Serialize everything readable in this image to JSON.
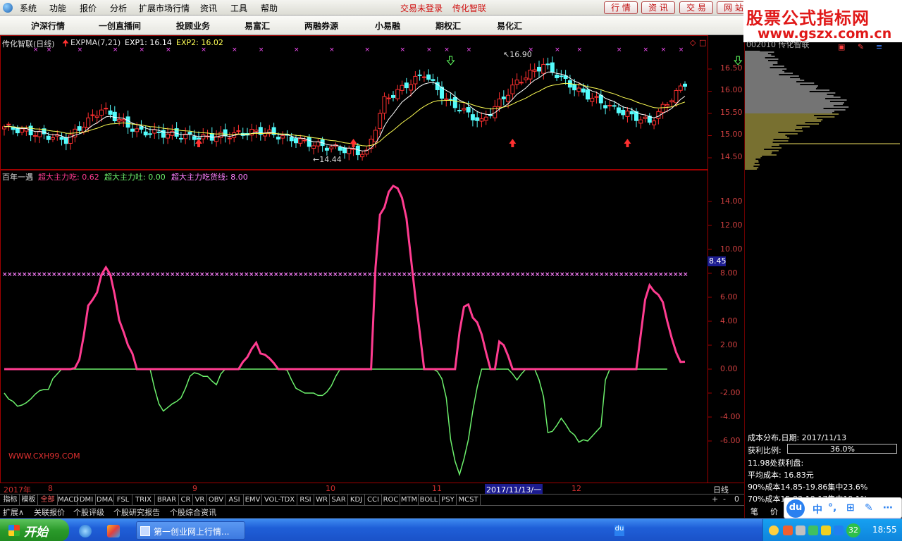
{
  "menubar": {
    "items": [
      "系统",
      "功能",
      "报价",
      "分析",
      "扩展市场行情",
      "资讯",
      "工具",
      "帮助"
    ],
    "status_login": "交易未登录",
    "status_brand": "传化智联",
    "buttons": [
      "行 情",
      "资 讯",
      "交 易",
      "网 站"
    ]
  },
  "toolbar2": {
    "items": [
      "沪深行情",
      "一创直播间",
      "投顾业务",
      "易富汇",
      "两融券源",
      "小易融",
      "期权汇",
      "易化汇"
    ]
  },
  "logo": {
    "line1": "股票公式指标网",
    "line2": "www.gszx.com.cn"
  },
  "main_chart": {
    "title": "传化智联(日线)",
    "indicator": "EXPMA(7,21)",
    "exp1": "EXP1: 16.14",
    "exp2": "EXP2: 16.02",
    "price_ticks": [
      "16.50",
      "16.00",
      "15.50",
      "15.00",
      "14.50"
    ],
    "high_label": "16.90",
    "low_label": "14.44",
    "colors": {
      "up": "#ff3030",
      "down": "#54fcfc",
      "exp1": "#ffffff",
      "exp2": "#ffff54",
      "mark": "#ff50ff"
    }
  },
  "sub_chart": {
    "title": "百年一遇",
    "l1": "超大主力吃: 0.62",
    "l2": "超大主力吐: 0.00",
    "l3": "超大主力吃货线: 8.00",
    "y_ticks": [
      "14.00",
      "12.00",
      "10.00",
      "8.00",
      "6.00",
      "4.00",
      "2.00",
      "0.00",
      "-2.00",
      "-4.00",
      "-6.00"
    ],
    "current_value": "8.45",
    "watermark": "WWW.CXH99.COM",
    "colors": {
      "eat": "#ff3c90",
      "spit": "#6cf06c",
      "threshold": "#ff80ff"
    }
  },
  "chart_data": [
    {
      "type": "line",
      "title": "百年一遇",
      "x": [
        "2017/08",
        "2017/09",
        "2017/10",
        "2017/11"
      ],
      "ylim": [
        -8.5,
        16
      ],
      "series": [
        {
          "name": "超大主力吃",
          "values": [
            0,
            0,
            0,
            0,
            0,
            0,
            0,
            0,
            0,
            0,
            0,
            0,
            0,
            0,
            0,
            0,
            0.1,
            0.8,
            2.8,
            5.3,
            5.8,
            6.4,
            7.9,
            8.5,
            7.9,
            6.2,
            4.1,
            3.1,
            2.0,
            1.3,
            0,
            0,
            0,
            0,
            0,
            0,
            0,
            0,
            0,
            0,
            0,
            0,
            0,
            0,
            0,
            0,
            0,
            0,
            0,
            0,
            0,
            0,
            0,
            0,
            0.6,
            1.0,
            1.7,
            2.2,
            1.3,
            1.2,
            0.9,
            0.5,
            0,
            0,
            0,
            0,
            0,
            0,
            0,
            0,
            0,
            0,
            0,
            0,
            0,
            0,
            0,
            0,
            0,
            0,
            0,
            0,
            0,
            0,
            8.5,
            12.9,
            13.5,
            14.8,
            15.3,
            15.1,
            14.3,
            12.6,
            9.3,
            6.0,
            3.1,
            0,
            0,
            0,
            0,
            0,
            0,
            0,
            0,
            3.1,
            5.2,
            5.4,
            4.3,
            3.9,
            2.9,
            1.4,
            0,
            0,
            2.3,
            2.0,
            1.1,
            0,
            0,
            0,
            0,
            0,
            0,
            0,
            0,
            0,
            0,
            0,
            0,
            0,
            0,
            0,
            0,
            0,
            0,
            0,
            0,
            0,
            0,
            0,
            0,
            0,
            0,
            0,
            0,
            0,
            2.9,
            5.8,
            7.0,
            6.5,
            6.2,
            5.6,
            4.0,
            2.6,
            1.4,
            0.6,
            0.62
          ]
        },
        {
          "name": "超大主力吐",
          "values": [
            -2.0,
            -2.5,
            -2.7,
            -3.1,
            -3.0,
            -2.8,
            -2.5,
            -2.1,
            -1.8,
            -1.7,
            -1.7,
            -0.8,
            -0.4,
            0,
            0,
            0,
            0,
            0,
            0,
            0,
            0,
            0,
            0,
            0,
            0,
            0,
            0,
            0,
            0,
            0,
            0,
            0,
            0,
            0,
            -1.6,
            -2.9,
            -3.5,
            -3.2,
            -2.9,
            -2.7,
            -2.4,
            -1.6,
            -0.6,
            -0.3,
            -0.4,
            -0.6,
            -0.6,
            -1.0,
            -1.3,
            -0.4,
            0,
            0,
            0,
            0,
            0,
            0,
            0,
            0,
            0,
            0,
            0,
            0,
            0,
            0,
            -0.1,
            -0.9,
            -1.6,
            -1.8,
            -2.0,
            -2.0,
            -2.0,
            -2.2,
            -2.2,
            -1.9,
            -1.4,
            -0.6,
            0,
            0,
            0,
            0,
            0,
            0,
            0,
            0,
            0,
            0,
            0,
            0,
            0,
            0,
            0,
            0,
            0,
            0,
            0,
            0,
            0,
            0,
            -0.2,
            -0.8,
            -2.4,
            -5.9,
            -7.7,
            -8.8,
            -7.5,
            -5.9,
            -3.5,
            -1.5,
            0,
            0,
            0,
            0,
            0,
            0,
            0,
            -0.4,
            -0.9,
            -0.4,
            0,
            0,
            0,
            -0.9,
            -2.3,
            -5.3,
            -5.2,
            -4.7,
            -4.1,
            -4.6,
            -5.2,
            -5.5,
            -6.1,
            -5.9,
            -6.0,
            -5.6,
            -5.2,
            -4.8,
            -0.9,
            0,
            0,
            0,
            0,
            0,
            0,
            0,
            0,
            0,
            0,
            0,
            0,
            0,
            0
          ]
        },
        {
          "name": "超大主力吃货线",
          "values": [
            8.0
          ]
        }
      ]
    },
    {
      "type": "line",
      "title": "EXPMA(7,21)",
      "ylim": [
        14.3,
        17.0
      ],
      "series": [
        {
          "name": "EXP1",
          "values": [
            16.14
          ]
        },
        {
          "name": "EXP2",
          "values": [
            16.02
          ]
        }
      ],
      "annotations": [
        {
          "label": "16.90",
          "kind": "high"
        },
        {
          "label": "14.44",
          "kind": "low"
        }
      ]
    }
  ],
  "xaxis": {
    "year": "2017年",
    "months": [
      "8",
      "9",
      "10",
      "11",
      "12"
    ],
    "cursor_date": "2017/11/13/一",
    "unit": "日线"
  },
  "indicator_tabs": [
    "指标",
    "模板",
    "全部",
    "MACD",
    "DMI",
    "DMA",
    "FSL",
    "TRIX",
    "BRAR",
    "CR",
    "VR",
    "OBV",
    "ASI",
    "EMV",
    "VOL-TDX",
    "RSI",
    "WR",
    "SAR",
    "KDJ",
    "CCI",
    "ROC",
    "MTM",
    "BOLL",
    "PSY",
    "MCST"
  ],
  "tab_controls": [
    "+",
    "-",
    "0"
  ],
  "bottom_tabs": [
    "扩展∧",
    "关联报价",
    "个股评级",
    "个股研究报告",
    "个股综合资讯"
  ],
  "right_panel": {
    "title": "002010 传化智联",
    "cost_date": "成本分布,日期: 2017/11/13",
    "profit_ratio_label": "获利比例:",
    "profit_ratio": "36.0%",
    "profit_at": "11.98处获利盘:",
    "avg_cost": "平均成本: 16.83元",
    "c90": "90%成本14.85-19.86集中23.6%",
    "c70": "70%成本15.83-19.17集中19.1%",
    "tab1": "笔",
    "tab2": "价"
  },
  "ime": {
    "logo": "du",
    "chars": [
      "中",
      "°,",
      "⊞",
      "✎",
      "⋯"
    ]
  },
  "taskbar": {
    "start": "开始",
    "task": "第一创业网上行情...",
    "du": "du",
    "badge": "32",
    "clock": "18:55"
  }
}
